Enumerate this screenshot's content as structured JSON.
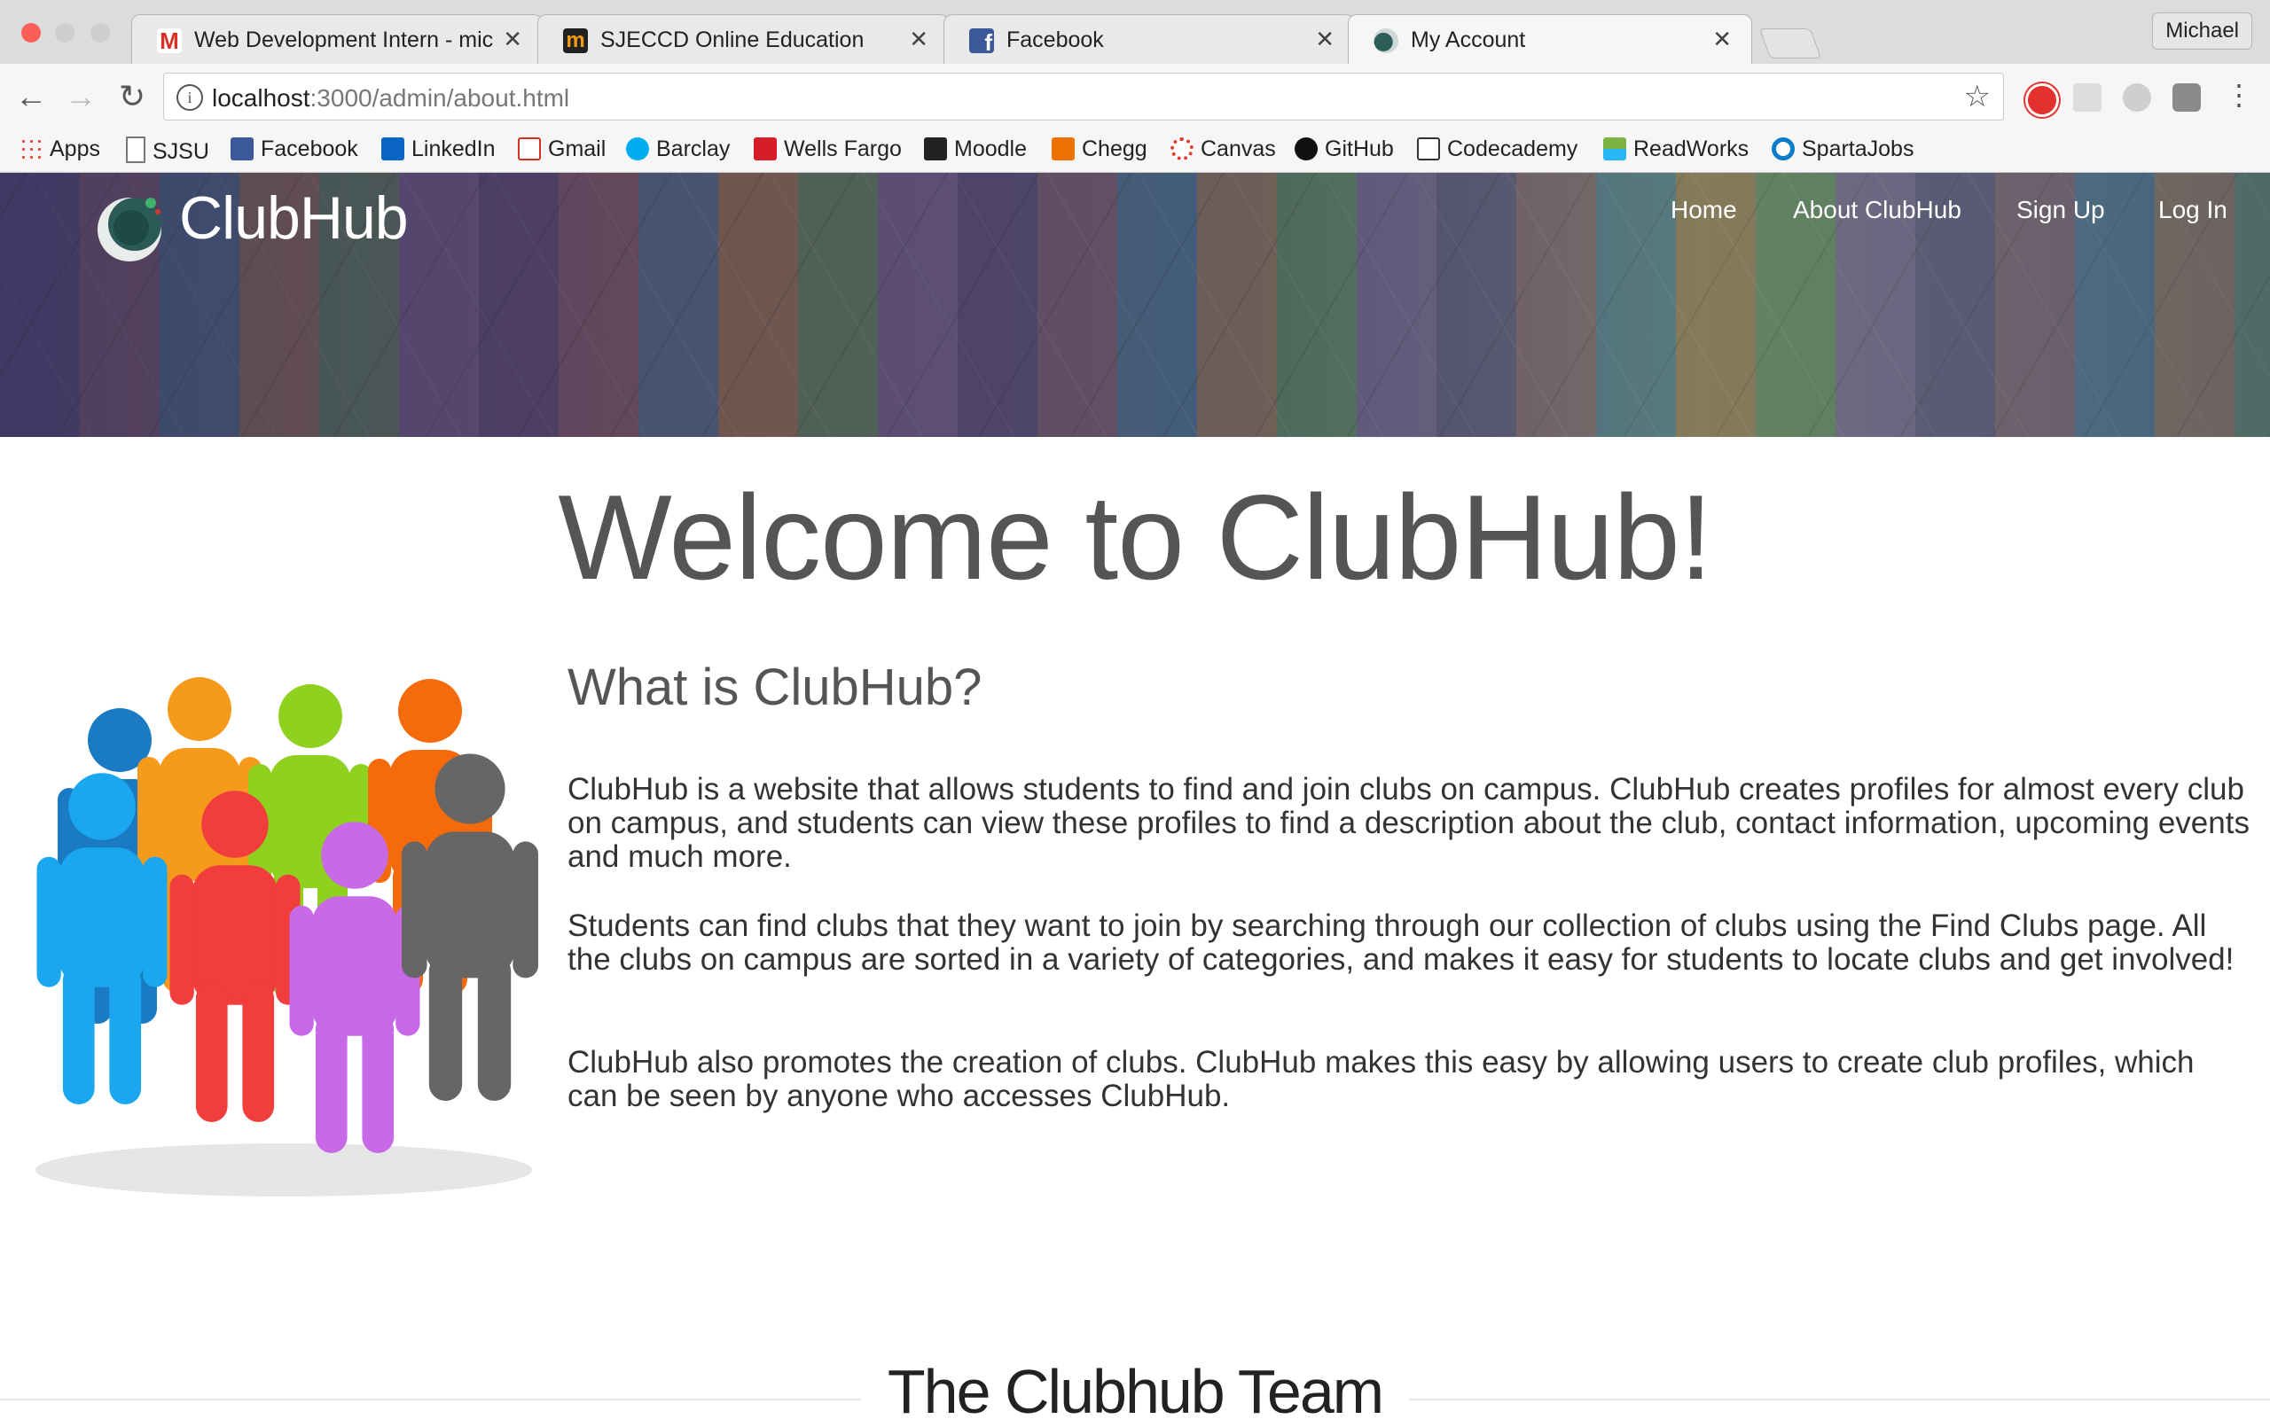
{
  "browser": {
    "tabs": [
      {
        "title": "Web Development Intern - mic",
        "favicon": "gmail-icon",
        "active": false
      },
      {
        "title": "SJECCD Online Education",
        "favicon": "moodle-icon",
        "active": false
      },
      {
        "title": "Facebook",
        "favicon": "facebook-icon",
        "active": false
      },
      {
        "title": "My Account",
        "favicon": "clubhub-icon",
        "active": true
      }
    ],
    "profile_name": "Michael",
    "url_host": "localhost",
    "url_path": ":3000/admin/about.html",
    "bookmarks": [
      {
        "label": "Apps",
        "icon": "apps-grid-icon"
      },
      {
        "label": "SJSU",
        "icon": "page-icon"
      },
      {
        "label": "Facebook",
        "icon": "facebook-icon"
      },
      {
        "label": "LinkedIn",
        "icon": "linkedin-icon"
      },
      {
        "label": "Gmail",
        "icon": "gmail-icon"
      },
      {
        "label": "Barclay",
        "icon": "barclay-icon"
      },
      {
        "label": "Wells Fargo",
        "icon": "wells-fargo-icon"
      },
      {
        "label": "Moodle",
        "icon": "moodle-icon"
      },
      {
        "label": "Chegg",
        "icon": "chegg-icon"
      },
      {
        "label": "Canvas",
        "icon": "canvas-icon"
      },
      {
        "label": "GitHub",
        "icon": "github-icon"
      },
      {
        "label": "Codecademy",
        "icon": "codecademy-icon"
      },
      {
        "label": "ReadWorks",
        "icon": "readworks-icon"
      },
      {
        "label": "SpartaJobs",
        "icon": "spartajobs-icon"
      }
    ]
  },
  "site": {
    "brand": "ClubHub",
    "nav": [
      "Home",
      "About ClubHub",
      "Sign Up",
      "Log In"
    ],
    "welcome": "Welcome to ClubHub!",
    "what_heading": "What is ClubHub?",
    "paragraphs": [
      "ClubHub is a website that allows students to find and join clubs on campus. ClubHub creates profiles for almost every club on campus, and students can view these profiles to find a description about the club, contact information, upcoming events and much more.",
      "Students can find clubs that they want to join by searching through our collection of clubs using the Find Clubs page. All the clubs on campus are sorted in a variety of categories, and makes it easy for students to locate clubs and get involved!",
      "ClubHub also promotes the creation of clubs. ClubHub makes this easy by allowing users to create club profiles, which can be seen by anyone who accesses ClubHub."
    ],
    "team_heading": "The Clubhub Team"
  },
  "colors": {
    "people": [
      "#1a7bc4",
      "#f59a1b",
      "#8fd11f",
      "#f56a0a",
      "#1aa7f0",
      "#f23d3d",
      "#c86ae8",
      "#666666"
    ],
    "heading_text": "#555555"
  }
}
